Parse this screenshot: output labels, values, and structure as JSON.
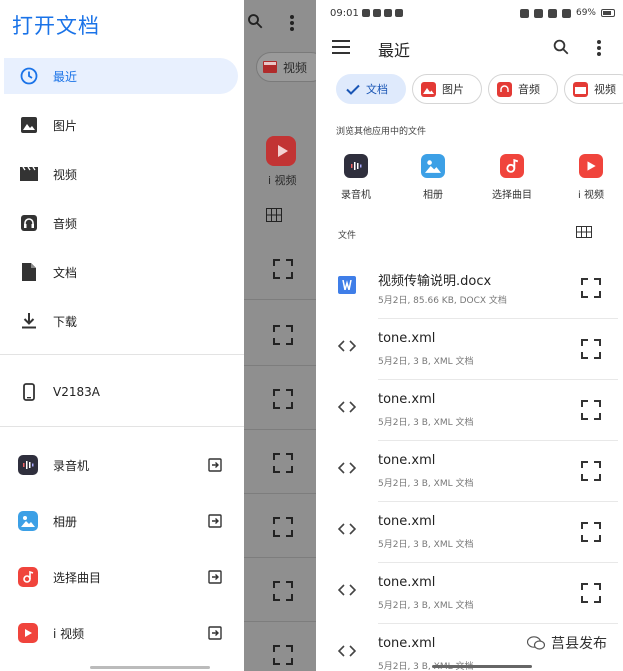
{
  "drawer": {
    "title": "打开文档",
    "nav_items": [
      {
        "label": "最近",
        "icon": "clock-icon"
      },
      {
        "label": "图片",
        "icon": "image-icon"
      },
      {
        "label": "视频",
        "icon": "movie-icon"
      },
      {
        "label": "音频",
        "icon": "headphones-icon"
      },
      {
        "label": "文档",
        "icon": "document-icon"
      },
      {
        "label": "下载",
        "icon": "download-icon"
      }
    ],
    "device": {
      "label": "V2183A",
      "icon": "phone-icon"
    },
    "apps": [
      {
        "label": "录音机",
        "icon": "recorder-app-icon",
        "color": "#2f2f3d"
      },
      {
        "label": "相册",
        "icon": "gallery-app-icon",
        "color": "#3ca0e6"
      },
      {
        "label": "选择曲目",
        "icon": "music-app-icon",
        "color": "#f0443c"
      },
      {
        "label": "i 视频",
        "icon": "video-app-icon",
        "color": "#f0443c"
      }
    ]
  },
  "background": {
    "chip_label": "视频",
    "app_label": "i 视频"
  },
  "status_bar": {
    "time": "09:01",
    "battery": "69%"
  },
  "main": {
    "title": "最近",
    "chips": [
      {
        "label": "文档",
        "icon": "check-icon",
        "selected": true
      },
      {
        "label": "图片",
        "icon": "image-icon",
        "selected": false
      },
      {
        "label": "音频",
        "icon": "headphones-icon",
        "selected": false
      },
      {
        "label": "视频",
        "icon": "movie-icon",
        "selected": false
      }
    ],
    "browse_label": "浏览其他应用中的文件",
    "apps": [
      {
        "label": "录音机",
        "icon": "recorder-app-icon",
        "color": "#2f2f3d"
      },
      {
        "label": "相册",
        "icon": "gallery-app-icon",
        "color": "#3ca0e6"
      },
      {
        "label": "选择曲目",
        "icon": "music-app-icon",
        "color": "#f0443c"
      },
      {
        "label": "i 视频",
        "icon": "video-app-icon",
        "color": "#f0443c"
      }
    ],
    "files_label": "文件",
    "files": [
      {
        "name": "视频传输说明.docx",
        "meta": "5月2日, 85.66 KB, DOCX 文档",
        "icon": "word-doc-icon"
      },
      {
        "name": "tone.xml",
        "meta": "5月2日, 3 B, XML 文档",
        "icon": "code-icon"
      },
      {
        "name": "tone.xml",
        "meta": "5月2日, 3 B, XML 文档",
        "icon": "code-icon"
      },
      {
        "name": "tone.xml",
        "meta": "5月2日, 3 B, XML 文档",
        "icon": "code-icon"
      },
      {
        "name": "tone.xml",
        "meta": "5月2日, 3 B, XML 文档",
        "icon": "code-icon"
      },
      {
        "name": "tone.xml",
        "meta": "5月2日, 3 B, XML 文档",
        "icon": "code-icon"
      },
      {
        "name": "tone.xml",
        "meta": "5月2日, 3 B, XML 文档",
        "icon": "code-icon"
      }
    ]
  },
  "watermark": "莒县发布",
  "colors": {
    "accent": "#1a73e8",
    "selected_chip_bg": "#dfeafc",
    "scrim": "#8f8f8f"
  }
}
